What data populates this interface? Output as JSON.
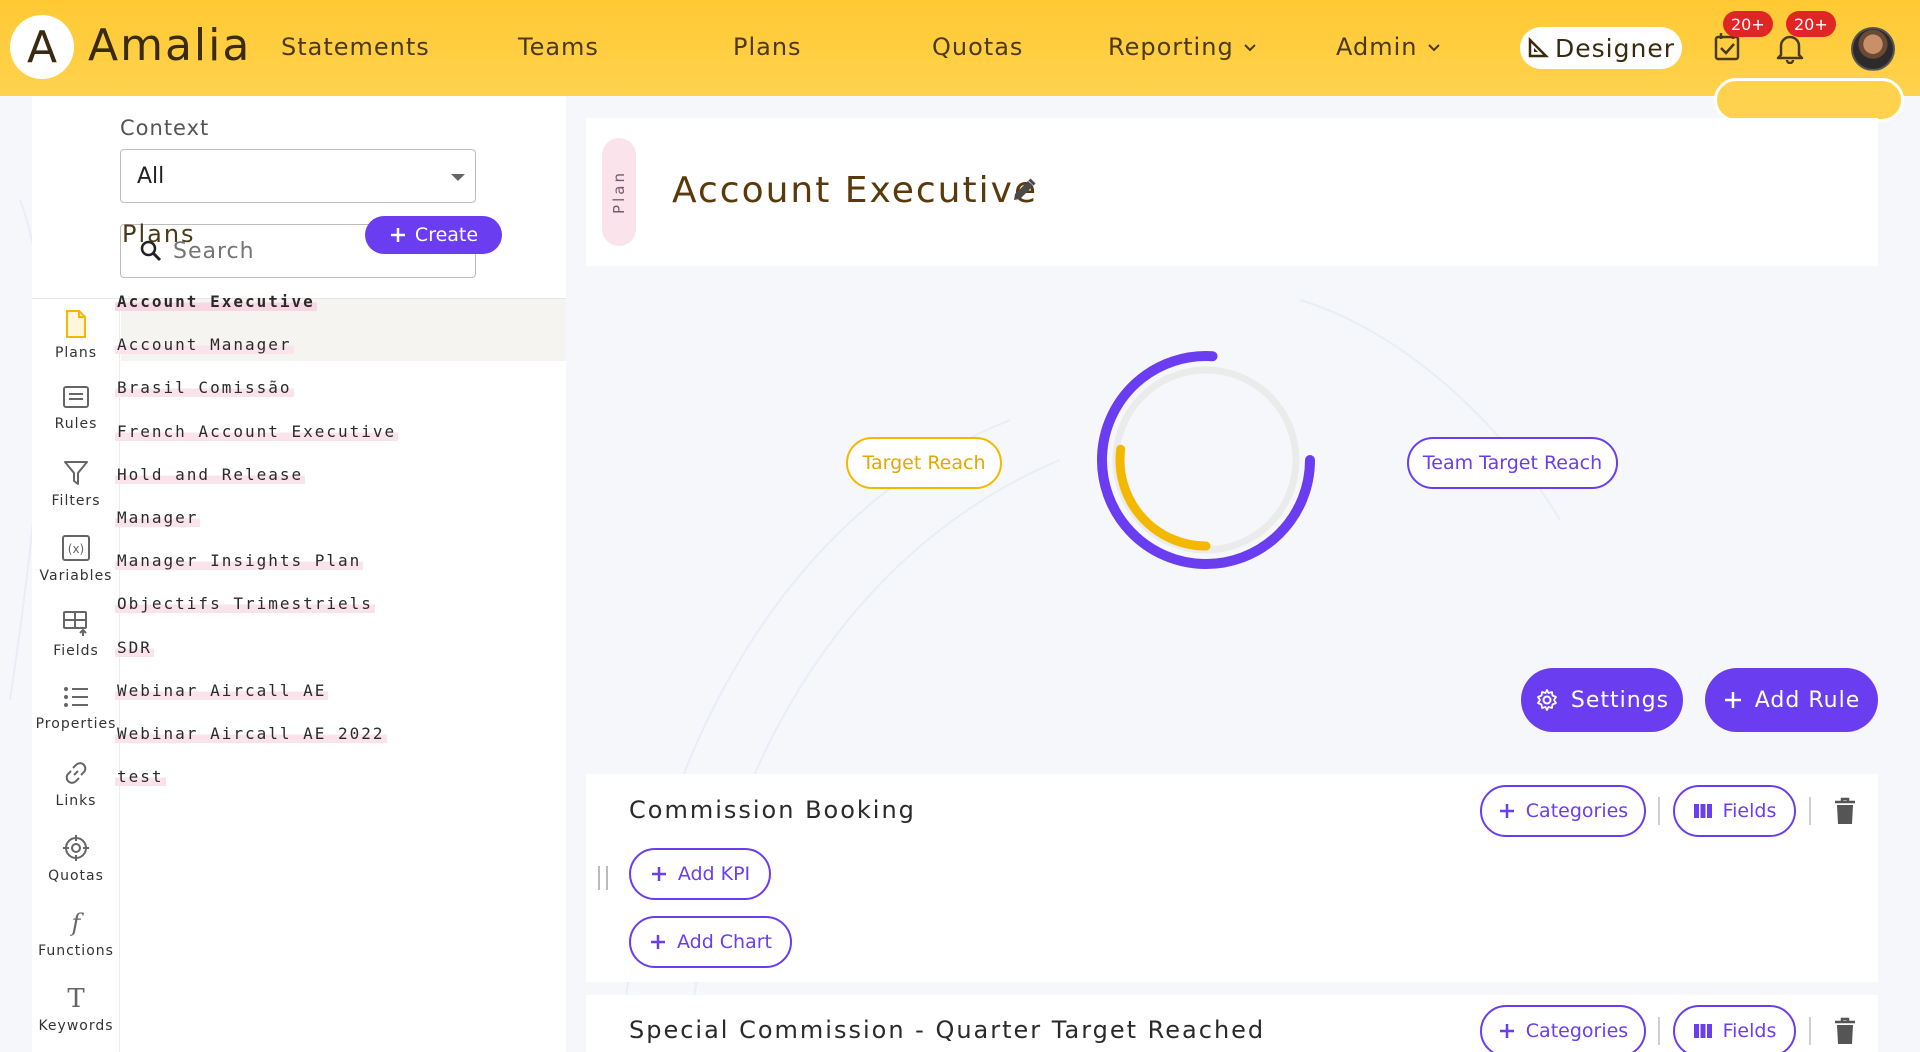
{
  "brand": {
    "logo_letter": "A",
    "name": "Amalia"
  },
  "nav": {
    "statements": "Statements",
    "teams": "Teams",
    "plans": "Plans",
    "quotas": "Quotas",
    "reporting": "Reporting",
    "admin": "Admin",
    "designer": "Designer"
  },
  "badges": {
    "tasks": "20+",
    "notifications": "20+"
  },
  "context": {
    "label": "Context",
    "value": "All"
  },
  "search": {
    "placeholder": "Search"
  },
  "rail": [
    {
      "label": "Plans",
      "icon": "file-icon"
    },
    {
      "label": "Rules",
      "icon": "rules-icon"
    },
    {
      "label": "Filters",
      "icon": "filter-icon"
    },
    {
      "label": "Variables",
      "icon": "variable-icon"
    },
    {
      "label": "Fields",
      "icon": "fields-icon"
    },
    {
      "label": "Properties",
      "icon": "list-icon"
    },
    {
      "label": "Links",
      "icon": "link-icon"
    },
    {
      "label": "Quotas",
      "icon": "target-icon"
    },
    {
      "label": "Functions",
      "icon": "function-icon"
    },
    {
      "label": "Keywords",
      "icon": "text-icon"
    }
  ],
  "plans_panel": {
    "title": "Plans",
    "create_label": "Create",
    "items": [
      "Account Executive",
      "Account Manager",
      "Brasil Comissão",
      "French Account Executive",
      "Hold and Release",
      "Manager",
      "Manager Insights Plan",
      "Objectifs Trimestriels",
      "SDR",
      "Webinar Aircall AE",
      "Webinar Aircall AE 2022",
      "test"
    ]
  },
  "plan": {
    "tag": "Plan",
    "title": "Account Executive"
  },
  "gauge": {
    "target_reach_label": "Target Reach",
    "team_target_reach_label": "Team Target Reach",
    "target_reach_fraction": 0.27,
    "team_target_reach_fraction": 0.76
  },
  "actions": {
    "settings": "Settings",
    "add_rule": "Add Rule"
  },
  "rules": [
    {
      "title": "Commission Booking",
      "categories_label": "Categories",
      "fields_label": "Fields",
      "add_kpi_label": "Add KPI",
      "add_chart_label": "Add Chart"
    },
    {
      "title": "Special Commission - Quarter Target Reached",
      "categories_label": "Categories",
      "fields_label": "Fields"
    }
  ],
  "colors": {
    "accent": "#6a3df0",
    "brand_yellow": "#ffc933",
    "target_yellow": "#f5b800"
  }
}
